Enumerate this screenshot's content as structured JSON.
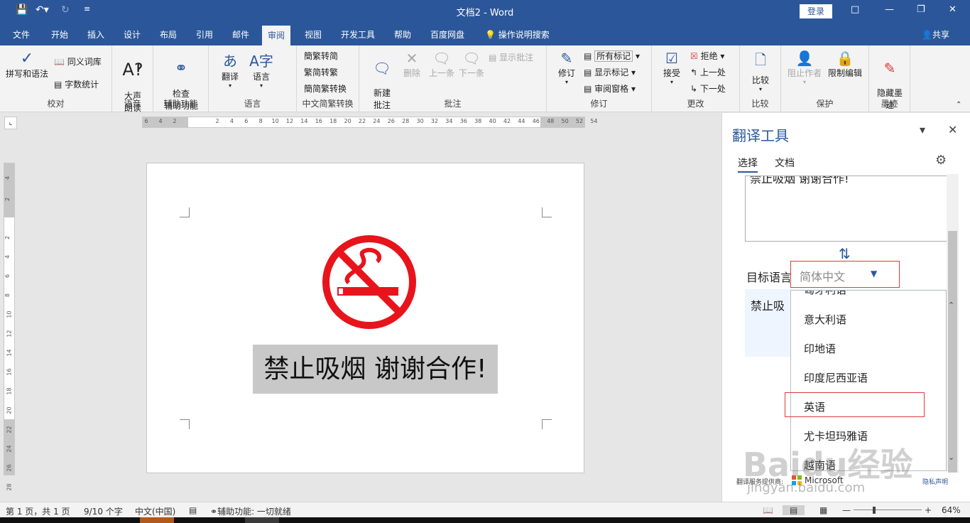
{
  "window": {
    "title": "文档2  -  Word",
    "login": "登录"
  },
  "tabs": [
    "文件",
    "开始",
    "插入",
    "设计",
    "布局",
    "引用",
    "邮件",
    "审阅",
    "视图",
    "开发工具",
    "帮助",
    "百度网盘"
  ],
  "active_tab": "审阅",
  "tell_me": "操作说明搜索",
  "share": "共享",
  "ribbon": {
    "proofing": {
      "label": "校对",
      "spelling": "拼写和语法",
      "thesaurus": "同义词库",
      "word_count": "字数统计"
    },
    "speech": {
      "label": "语音",
      "read_aloud": "大声\n朗读"
    },
    "accessibility": {
      "label": "辅助功能",
      "check": "检查\n辅助功能"
    },
    "language": {
      "label": "语言",
      "translate": "翻译",
      "language": "语言"
    },
    "chinese": {
      "label": "中文简繁转换",
      "to_simplified": "繁转简",
      "to_traditional": "简转繁",
      "convert": "简繁转换"
    },
    "comments": {
      "label": "批注",
      "new": "新建\n批注",
      "delete": "删除",
      "prev": "上一条",
      "next": "下一条",
      "show": "显示批注"
    },
    "tracking": {
      "label": "修订",
      "track": "修订",
      "all_markup": "所有标记",
      "show_markup": "显示标记",
      "review_pane": "审阅窗格"
    },
    "changes": {
      "label": "更改",
      "accept": "接受",
      "reject": "拒绝",
      "prev": "上一处",
      "next": "下一处"
    },
    "compare": {
      "label": "比较",
      "compare": "比较"
    },
    "protect": {
      "label": "保护",
      "block": "阻止作者",
      "restrict": "限制编辑"
    },
    "ink": {
      "label": "墨迹",
      "hide": "隐藏墨\n迹"
    }
  },
  "document": {
    "text": "禁止吸烟  谢谢合作!",
    "sign_color": "#e8141c"
  },
  "translator": {
    "title": "翻译工具",
    "tab_selection": "选择",
    "tab_document": "文档",
    "source_text": "禁止吸烟 谢谢合作!",
    "target_label": "目标语言",
    "target_value": "简体中文",
    "output_text": "禁止吸",
    "languages": [
      "匈牙利语",
      "意大利语",
      "印地语",
      "印度尼西亚语",
      "英语",
      "尤卡坦玛雅语",
      "越南语"
    ],
    "highlighted": "英语",
    "provider": "翻译服务提供商:",
    "provider_name": "Microsoft",
    "privacy": "隐私声明"
  },
  "status": {
    "page": "第 1 页，共 1 页",
    "words": "9/10 个字",
    "lang": "中文(中国)",
    "accessibility": "辅助功能: 一切就绪",
    "zoom": "64%"
  },
  "ruler": {
    "h_ticks": [
      "6",
      "4",
      "2",
      "2",
      "4",
      "6",
      "8",
      "10",
      "12",
      "14",
      "16",
      "18",
      "20",
      "22",
      "24",
      "26",
      "28",
      "30",
      "32",
      "34",
      "36",
      "38",
      "40",
      "42",
      "44",
      "46",
      "48",
      "50",
      "52",
      "54"
    ],
    "v_ticks": [
      "4",
      "2",
      "2",
      "4",
      "6",
      "8",
      "10",
      "12",
      "14",
      "16",
      "18",
      "20",
      "22",
      "24",
      "26",
      "28"
    ]
  },
  "watermark": {
    "brand": "Baidu经验",
    "url": "jingyan.baidu.com"
  }
}
